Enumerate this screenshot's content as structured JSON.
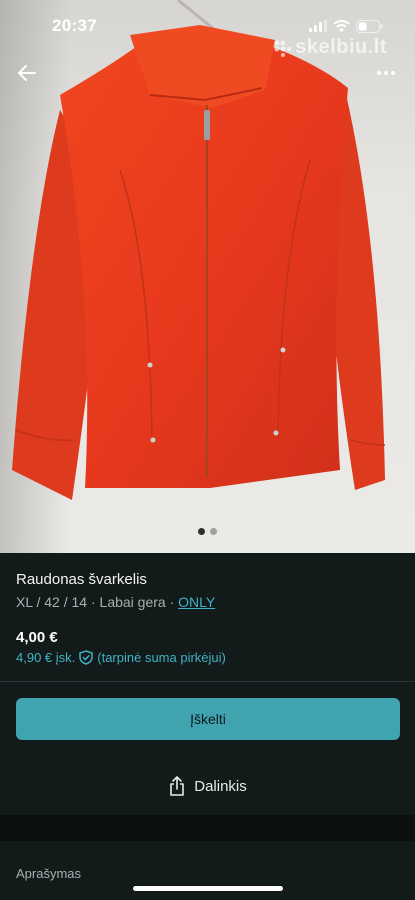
{
  "status_bar": {
    "time": "20:37"
  },
  "watermark": {
    "text": "skelbiu.lt"
  },
  "icons": {
    "back": "arrow-left-icon",
    "more": "more-dots-icon",
    "share": "share-icon",
    "shield": "shield-check-icon",
    "signal": "cellular-signal-icon",
    "wifi": "wifi-icon",
    "battery": "battery-icon"
  },
  "gallery": {
    "total": 2,
    "current": 1
  },
  "item": {
    "title": "Raudonas švarkelis",
    "meta_prefix": "XL / 42 / 14 · Labai gera · ",
    "brand": "ONLY",
    "price": "4,00 €",
    "price_incl_amount": "4,90 € įsk.",
    "price_incl_note": "(tarpinė suma pirkėjui)"
  },
  "actions": {
    "buy_label": "Įškelti",
    "share_label": "Dalinkis"
  },
  "description": {
    "heading": "Aprašymas"
  },
  "colors": {
    "accent": "#3fa3b0",
    "link": "#3fb3c4",
    "background": "#121a1a",
    "jacket": "#e8391d"
  }
}
